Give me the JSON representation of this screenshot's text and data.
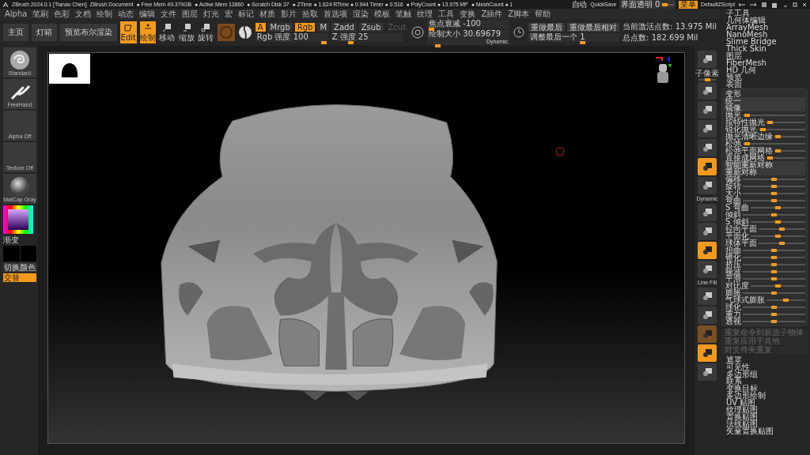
{
  "title_bar": {
    "app": "ZBrush 2024.0.1 [Tianao Chen]",
    "document": "ZBrush Document",
    "stats": [
      "● Free Mem 49.379GB",
      "● Active Mem 13860",
      "● Scratch Disk 37",
      "● ZTime ● 1.624 RTime ● 0.944 Timer ● 0.516",
      "● PolyCount ● 13.975 MP",
      "● MeshCount ● 1"
    ],
    "auto": "自动",
    "quicksave": "QuickSave",
    "transparency": {
      "label": "界面透明 0",
      "level": 0.05
    },
    "menu": {
      "label": "菜单",
      "on": true
    },
    "script": "DefaultZScript"
  },
  "menu_bar": [
    "Alpha",
    "笔刷",
    "色彩",
    "文档",
    "绘制",
    "动态",
    "编辑",
    "文件",
    "图层",
    "灯光",
    "宏",
    "标记",
    "材质",
    "影片",
    "拾取",
    "首选项",
    "渲染",
    "模板",
    "笔触",
    "纹理",
    "工具",
    "变换",
    "Z插件",
    "Z脚本",
    "帮助"
  ],
  "toolbar": {
    "buttons": [
      "主页",
      "灯箱",
      "预览布尔渲染"
    ],
    "modes": [
      {
        "label": "Edit",
        "selected": true
      },
      {
        "label": "绘制",
        "selected": true
      },
      {
        "label": "移动",
        "selected": false
      },
      {
        "label": "缩放",
        "selected": false
      },
      {
        "label": "旋转",
        "selected": false
      }
    ],
    "channels": [
      {
        "label": "A",
        "selected": true
      },
      {
        "label": "Mrgb",
        "selected": false
      },
      {
        "label": "Rgb",
        "selected": true
      },
      {
        "label": "M",
        "selected": false
      }
    ],
    "zmodes": [
      {
        "label": "Zadd",
        "disabled": false
      },
      {
        "label": "Zsub",
        "disabled": false
      },
      {
        "label": "Zcut",
        "disabled": true
      }
    ],
    "intensity": [
      {
        "label": "Rgb 强度 100",
        "level": 1
      },
      {
        "label": "Z 强度 25",
        "level": 0.25
      }
    ],
    "brush": [
      {
        "label": "焦点衰减 -100",
        "level": 0
      },
      {
        "label": "绘制大小 30.69679",
        "level": 0.08
      }
    ],
    "dynamic": "Dynamic",
    "redo": [
      "重做最后",
      "重做最后相对"
    ],
    "adjust": {
      "label": "调整最后一个 1",
      "level": 0.6
    },
    "stats": [
      "当前激活点数: 13.975 Mil",
      "总点数: 182.699 Mil"
    ]
  },
  "palette": {
    "tiles": [
      {
        "label": "Standard",
        "kind": "brush"
      },
      {
        "label": "FreeHand",
        "kind": "stroke"
      },
      {
        "label": "Alpha Off",
        "kind": "alpha"
      },
      {
        "label": "Texture Off",
        "kind": "texture"
      },
      {
        "label": "MatCap Gray",
        "kind": "material"
      }
    ],
    "gradient": "渐变",
    "switch_color": "切换颜色",
    "alternate": {
      "label": "交替",
      "on": true
    }
  },
  "icon_bar": [
    {
      "kind": "button",
      "selected": false
    },
    {
      "kind": "caption",
      "label": "子像素",
      "level": 0.5
    },
    {
      "kind": "button",
      "selected": false
    },
    {
      "kind": "button",
      "selected": false
    },
    {
      "kind": "button",
      "selected": false
    },
    {
      "kind": "button",
      "selected": false
    },
    {
      "kind": "button",
      "selected": true
    },
    {
      "kind": "button",
      "selected": false
    },
    {
      "kind": "caption",
      "label": "Dynamic"
    },
    {
      "kind": "button",
      "selected": false
    },
    {
      "kind": "button",
      "selected": false
    },
    {
      "kind": "button",
      "selected": true
    },
    {
      "kind": "button",
      "selected": false
    },
    {
      "kind": "caption",
      "label": "Line Fill"
    },
    {
      "kind": "button",
      "selected": false
    },
    {
      "kind": "button",
      "selected": false
    },
    {
      "kind": "ghost",
      "selected": true
    },
    {
      "kind": "button",
      "selected": true
    },
    {
      "kind": "button",
      "selected": false
    }
  ],
  "tool_panel": {
    "top": [
      "子工具",
      "几何体编辑",
      "ArrayMesh",
      "NanoMesh",
      "Slime Bridge",
      "Thick Skin",
      "图层",
      "FiberMesh",
      "HD 几何",
      "预览",
      "表面"
    ],
    "deformation": {
      "title": "变形",
      "expanded": true,
      "items": [
        {
          "label": "统一",
          "kind": "button"
        },
        {
          "label": "镜像",
          "kind": "button"
        },
        {
          "label": "抛光",
          "kind": "slider",
          "level": 0.03
        },
        {
          "label": "按特性抛光",
          "kind": "slider",
          "level": 0.03
        },
        {
          "label": "锐化抛光",
          "kind": "slider",
          "level": 0.03
        },
        {
          "label": "抛光清晰边缘",
          "kind": "slider",
          "level": 0.03
        },
        {
          "label": "松弛",
          "kind": "slider",
          "level": 0.03
        },
        {
          "label": "松弛平面网格",
          "kind": "slider",
          "level": 0.03
        },
        {
          "label": "直接成网格",
          "kind": "slider",
          "level": 0.03
        },
        {
          "label": "智能重新对称",
          "kind": "button"
        },
        {
          "label": "重新对称",
          "kind": "button"
        },
        {
          "label": "偏移",
          "kind": "slider",
          "level": 0.5
        },
        {
          "label": "旋转",
          "kind": "slider",
          "level": 0.5
        },
        {
          "label": "大小",
          "kind": "slider",
          "level": 0.5
        },
        {
          "label": "弯曲",
          "kind": "slider",
          "level": 0.5
        },
        {
          "label": "S 弯曲",
          "kind": "slider",
          "level": 0.5
        },
        {
          "label": "倾斜",
          "kind": "slider",
          "level": 0.5
        },
        {
          "label": "S 倾斜",
          "kind": "slider",
          "level": 0.5
        },
        {
          "label": "径向平面",
          "kind": "slider",
          "level": 0.5
        },
        {
          "label": "平面化",
          "kind": "slider",
          "level": 0.5
        },
        {
          "label": "球体平面",
          "kind": "slider",
          "level": 0.5
        },
        {
          "label": "扭曲",
          "kind": "slider",
          "level": 0.5
        },
        {
          "label": "锥化",
          "kind": "slider",
          "level": 0.5
        },
        {
          "label": "挤压",
          "kind": "slider",
          "level": 0.5
        },
        {
          "label": "噪波",
          "kind": "slider",
          "level": 0.5
        },
        {
          "label": "平滑",
          "kind": "slider",
          "level": 0.5
        },
        {
          "label": "对比度",
          "kind": "slider",
          "level": 0.5
        },
        {
          "label": "膨胀",
          "kind": "slider",
          "level": 0.5
        },
        {
          "label": "气球式膨胀",
          "kind": "slider",
          "level": 0.5
        },
        {
          "label": "球化",
          "kind": "slider",
          "level": 0.5
        },
        {
          "label": "重力",
          "kind": "slider",
          "level": 0.5
        },
        {
          "label": "透视",
          "kind": "slider",
          "level": 0.5
        }
      ]
    },
    "actions": [
      {
        "label": "重复命令到新选子物体",
        "disabled": true
      },
      {
        "label": "重复应用于其他",
        "disabled": true
      },
      {
        "label": "对文件夹重复",
        "disabled": true
      }
    ],
    "bottom": [
      "遮罩",
      "可见性",
      "多边形组",
      "联系",
      "变换目标",
      "多边形绘制",
      "UV 贴图",
      "纹理贴图",
      "置换贴图",
      "法线贴图",
      "矢量置换贴图"
    ]
  }
}
